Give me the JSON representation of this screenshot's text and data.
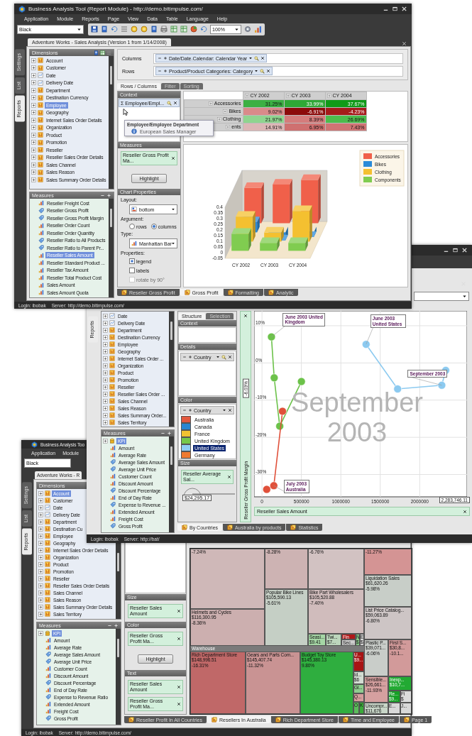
{
  "window_a": {
    "title": "Business Analysis Tool (Report Module) - http://demo.bitimpulse.com/",
    "menu": [
      "Application",
      "Module",
      "Reports",
      "Page",
      "View",
      "Data",
      "Table",
      "Language",
      "Help"
    ],
    "theme_select": "Black",
    "zoom_select": "100%",
    "document_tab": "Adventure Works - Sales Analysis (Version 1 from 1/14/2008)",
    "side_tabs": [
      {
        "label": "Settings",
        "selected": false
      },
      {
        "label": "List",
        "selected": false
      },
      {
        "label": "Reports",
        "selected": true
      }
    ],
    "dimensions": {
      "title": "Dimensions",
      "items": [
        {
          "label": "Account",
          "kind": "dimension",
          "selected": false
        },
        {
          "label": "Customer",
          "kind": "dimension",
          "selected": false
        },
        {
          "label": "Date",
          "kind": "time",
          "selected": false
        },
        {
          "label": "Delivery Date",
          "kind": "time",
          "selected": false
        },
        {
          "label": "Department",
          "kind": "dimension",
          "selected": false
        },
        {
          "label": "Destination Currency",
          "kind": "dimension",
          "selected": false
        },
        {
          "label": "Employee",
          "kind": "dimension",
          "selected": true
        },
        {
          "label": "Geography",
          "kind": "dimension",
          "selected": false
        },
        {
          "label": "Internet Sales Order Details",
          "kind": "dimension",
          "selected": false
        },
        {
          "label": "Organization",
          "kind": "dimension",
          "selected": false
        },
        {
          "label": "Product",
          "kind": "dimension",
          "selected": false
        },
        {
          "label": "Promotion",
          "kind": "dimension",
          "selected": false
        },
        {
          "label": "Reseller",
          "kind": "dimension",
          "selected": false
        },
        {
          "label": "Reseller Sales Order Details",
          "kind": "dimension",
          "selected": false
        },
        {
          "label": "Sales Channel",
          "kind": "dimension",
          "selected": false
        },
        {
          "label": "Sales Reason",
          "kind": "dimension",
          "selected": false
        },
        {
          "label": "Sales Summary Order Details",
          "kind": "dimension",
          "selected": false
        }
      ]
    },
    "measures": {
      "title": "Measures",
      "items": [
        {
          "label": "Reseller Freight Cost",
          "kind": "bars",
          "selected": false
        },
        {
          "label": "Reseller Gross Profit",
          "kind": "calculated",
          "selected": false
        },
        {
          "label": "Reseller Gross Profit Margin",
          "kind": "calculated",
          "selected": false
        },
        {
          "label": "Reseller Order Count",
          "kind": "bars",
          "selected": false
        },
        {
          "label": "Reseller Order Quantity",
          "kind": "bars",
          "selected": false
        },
        {
          "label": "Reseller Ratio to All Products",
          "kind": "calculated",
          "selected": false
        },
        {
          "label": "Reseller Ratio to Parent Pr...",
          "kind": "calculated",
          "selected": false
        },
        {
          "label": "Reseller Sales Amount",
          "kind": "bars",
          "selected": true
        },
        {
          "label": "Reseller Standard Product ...",
          "kind": "bars",
          "selected": false
        },
        {
          "label": "Reseller Tax Amount",
          "kind": "bars",
          "selected": false
        },
        {
          "label": "Reseller Total Product Cost",
          "kind": "bars",
          "selected": false
        },
        {
          "label": "Sales Amount",
          "kind": "bars",
          "selected": false
        },
        {
          "label": "Sales Amount Quota",
          "kind": "bars",
          "selected": false
        }
      ]
    },
    "axes_fields": [
      {
        "label": "Columns",
        "chip": "Date/Date.Calendar: Calendar Year"
      },
      {
        "label": "Rows",
        "chip": "Product/Product Categories: Category"
      }
    ],
    "config_tabs": [
      {
        "label": "Rows / Columns",
        "selected": true
      },
      {
        "label": "Filter",
        "selected": false
      },
      {
        "label": "Sorting",
        "selected": false
      }
    ],
    "context": {
      "title": "Context",
      "chip_symbol": "Σ",
      "chip": "Employee/Empl..."
    },
    "tooltip": {
      "title": "Employee/Employee Department",
      "text": "European Sales Manager"
    },
    "measures_box": {
      "title": "Measures",
      "chip": "Reseller Gross Profit Ma...",
      "button": "Highlight"
    },
    "chart_properties": {
      "title": "Chart Properties",
      "layout_label": "Layout:",
      "layout_value": "bottom",
      "argument_label": "Argument:",
      "argument_options": [
        {
          "label": "rows",
          "selected": false
        },
        {
          "label": "columns",
          "selected": true
        }
      ],
      "type_label": "Type:",
      "type_value": "Manhattan Bar",
      "properties_label": "Properties:",
      "options": [
        {
          "label": "legend",
          "checked": true,
          "disabled": false
        },
        {
          "label": "labels",
          "checked": false,
          "disabled": false
        },
        {
          "label": "rotate by 90°",
          "checked": false,
          "disabled": true
        }
      ]
    },
    "grid": {
      "columns": [
        "CY 2002",
        "CY 2003",
        "CY 2004"
      ],
      "rows": [
        {
          "label": "Accessories",
          "cells": [
            {
              "value": "31.25%",
              "color": "#3cb043"
            },
            {
              "value": "33.99%",
              "color": "#2fa836"
            },
            {
              "value": "37.67%",
              "color": "#109a18"
            }
          ]
        },
        {
          "label": "Bikes",
          "cells": [
            {
              "value": "9.02%",
              "color": "#d98a8a"
            },
            {
              "value": "-6.91%",
              "color": "#8c0a0a"
            },
            {
              "value": "-4.23%",
              "color": "#a51a1a"
            }
          ]
        },
        {
          "label": "Clothing",
          "cells": [
            {
              "value": "21.97%",
              "color": "#8fd48f"
            },
            {
              "value": "8.39%",
              "color": "#d47c7c"
            },
            {
              "value": "26.69%",
              "color": "#4cbc4c"
            }
          ]
        },
        {
          "label": "ents",
          "cells": [
            {
              "value": "14.91%",
              "color": "#dcb6b6"
            },
            {
              "value": "6.95%",
              "color": "#cf7070"
            },
            {
              "value": "7.43%",
              "color": "#d07474"
            }
          ]
        }
      ]
    },
    "chart": {
      "yaxis_labels": [
        "0.4",
        "0.35",
        "0.3",
        "0.25",
        "0.2",
        "0.15",
        "0.1",
        "0.05",
        "0",
        "-0.05"
      ],
      "categories": [
        "CY 2002",
        "CY 2003",
        "CY 2004"
      ],
      "legend": [
        {
          "label": "Accessories",
          "color": "#f0604a"
        },
        {
          "label": "Bikes",
          "color": "#2a8ad8"
        },
        {
          "label": "Clothing",
          "color": "#f4c030"
        },
        {
          "label": "Components",
          "color": "#80cc50"
        }
      ]
    },
    "report_tabs": [
      {
        "label": "Reseller Gross Profit",
        "selected": false
      },
      {
        "label": "Gross Profit",
        "selected": true
      },
      {
        "label": "Formatting",
        "selected": false
      },
      {
        "label": "Analytic",
        "selected": false
      }
    ],
    "status_bar": {
      "login": "Login: ibobak",
      "server": "Server: http://demo.bitimpulse.com/"
    }
  },
  "window_b": {
    "side_tabs": [
      {
        "label": "Reports",
        "selected": true
      }
    ],
    "dimensions": {
      "items": [
        {
          "label": "Date",
          "kind": "time",
          "selected": false
        },
        {
          "label": "Delivery Date",
          "kind": "time",
          "selected": false
        },
        {
          "label": "Department",
          "kind": "dimension",
          "selected": false
        },
        {
          "label": "Destination Currency",
          "kind": "dimension",
          "selected": false
        },
        {
          "label": "Employee",
          "kind": "dimension",
          "selected": false
        },
        {
          "label": "Geography",
          "kind": "dimension",
          "selected": false
        },
        {
          "label": "Internet Sales Order ...",
          "kind": "dimension",
          "selected": false
        },
        {
          "label": "Organization",
          "kind": "dimension",
          "selected": false
        },
        {
          "label": "Product",
          "kind": "dimension",
          "selected": false
        },
        {
          "label": "Promotion",
          "kind": "dimension",
          "selected": false
        },
        {
          "label": "Reseller",
          "kind": "dimension",
          "selected": false
        },
        {
          "label": "Reseller Sales Order ...",
          "kind": "dimension",
          "selected": false
        },
        {
          "label": "Sales Channel",
          "kind": "dimension",
          "selected": false
        },
        {
          "label": "Sales Reason",
          "kind": "dimension",
          "selected": false
        },
        {
          "label": "Sales Summary Order...",
          "kind": "dimension",
          "selected": false
        },
        {
          "label": "Sales Territory",
          "kind": "dimension",
          "selected": false
        }
      ]
    },
    "measures": {
      "title": "Measures",
      "items": [
        {
          "label": "KPI",
          "kind": "kpi",
          "selected": true
        },
        {
          "label": "Amount",
          "kind": "bars",
          "selected": false
        },
        {
          "label": "Average Rate",
          "kind": "bars",
          "selected": false
        },
        {
          "label": "Average Sales Amount",
          "kind": "calculated",
          "selected": false
        },
        {
          "label": "Average Unit Price",
          "kind": "calculated",
          "selected": false
        },
        {
          "label": "Customer Count",
          "kind": "bars",
          "selected": false
        },
        {
          "label": "Discount Amount",
          "kind": "bars",
          "selected": false
        },
        {
          "label": "Discount Percentage",
          "kind": "calculated",
          "selected": false
        },
        {
          "label": "End of Day Rate",
          "kind": "bars",
          "selected": false
        },
        {
          "label": "Expense to Revenue ...",
          "kind": "calculated",
          "selected": false
        },
        {
          "label": "Extended Amount",
          "kind": "bars",
          "selected": false
        },
        {
          "label": "Freight Cost",
          "kind": "bars",
          "selected": false
        },
        {
          "label": "Gross Profit",
          "kind": "calculated",
          "selected": false
        }
      ]
    },
    "structure_tabs": [
      {
        "label": "Structure",
        "selected": true
      },
      {
        "label": "Selection",
        "selected": false
      }
    ],
    "context": {
      "title": "Context"
    },
    "details": {
      "title": "Details",
      "chip": "Country"
    },
    "color_panel": {
      "title": "Color",
      "chip": "Country",
      "legend": [
        {
          "label": "Australia",
          "color": "#e2583e",
          "selected": false
        },
        {
          "label": "Canada",
          "color": "#2a86d0",
          "selected": false
        },
        {
          "label": "France",
          "color": "#f2c232",
          "selected": false
        },
        {
          "label": "United Kingdom",
          "color": "#76c84a",
          "selected": false
        },
        {
          "label": "United States",
          "color": "#8fcdf4",
          "selected": true
        },
        {
          "label": "Germany",
          "color": "#ef7a30",
          "selected": false
        }
      ]
    },
    "size_panel": {
      "title": "Size",
      "chip": "Reseller Average Sal...",
      "value": "$24,295.17"
    },
    "y_field": {
      "cursor": "-6.03%"
    },
    "x_field": {
      "cursor": "2,283,746.11"
    },
    "period_label": "September 2003",
    "chart_data": {
      "type": "scatter",
      "xlabel": "Reseller Sales Amount",
      "ylabel": "Reseller Gross Profit Margin",
      "grid": true,
      "xlim": [
        -100000,
        2600000
      ],
      "ylim": [
        -0.36,
        0.14
      ],
      "xticks": [
        0,
        500000,
        1000000,
        1500000,
        2000000
      ],
      "yticks": [
        {
          "value": 0.1,
          "label": "10%"
        },
        {
          "value": 0,
          "label": "0%"
        },
        {
          "value": -0.1,
          "label": "-10%"
        },
        {
          "value": -0.2,
          "label": "-20%"
        },
        {
          "value": -0.3,
          "label": "-30%"
        }
      ],
      "series": [
        {
          "color": "#6cc24a",
          "x": [
            120000,
            155000,
            225000,
            500000
          ],
          "values": [
            0.07,
            -0.04,
            -0.17,
            -0.05
          ]
        },
        {
          "color": "#e0503a",
          "x": [
            60000,
            150000,
            260000
          ],
          "values": [
            -0.34,
            -0.33,
            -0.13
          ]
        },
        {
          "color": "#8ccaf0",
          "x": [
            1320000,
            1720000,
            2280000,
            2330000
          ],
          "values": [
            0.05,
            -0.07,
            -0.06,
            -0.02
          ]
        }
      ],
      "annotations": [
        {
          "text": "June 2003 United Kingdom",
          "x": 120000,
          "y": 0.07
        },
        {
          "text": "June 2003 United States",
          "x": 1320000,
          "y": 0.05
        },
        {
          "text": "September 2003",
          "x": 2280000,
          "y": -0.06
        },
        {
          "text": "July 2003 Australia",
          "x": 150000,
          "y": -0.33
        }
      ]
    },
    "report_tabs": [
      {
        "label": "By Countries",
        "selected": true
      },
      {
        "label": "Australia by products",
        "selected": false
      },
      {
        "label": "Statistics",
        "selected": false
      }
    ],
    "status_bar": {
      "login": "Login: ibobak",
      "server": "Server: http://bat/"
    }
  },
  "window_c": {
    "title": "Business Analysis Too",
    "menu": [
      "Application",
      "Module"
    ],
    "theme_select": "Black",
    "document_tab": "Adventure Works - R",
    "side_tabs": [
      {
        "label": "Settings",
        "selected": false
      },
      {
        "label": "List",
        "selected": false
      },
      {
        "label": "Reports",
        "selected": true
      }
    ],
    "dimensions": {
      "title": "Dimensions",
      "items": [
        {
          "label": "Account",
          "kind": "dimension",
          "selected": true
        },
        {
          "label": "Customer",
          "kind": "dimension",
          "selected": false
        },
        {
          "label": "Date",
          "kind": "time",
          "selected": false
        },
        {
          "label": "Delivery Date",
          "kind": "time",
          "selected": false
        },
        {
          "label": "Department",
          "kind": "dimension",
          "selected": false
        },
        {
          "label": "Destination Cu",
          "kind": "dimension",
          "selected": false
        },
        {
          "label": "Employee",
          "kind": "dimension",
          "selected": false
        },
        {
          "label": "Geography",
          "kind": "dimension",
          "selected": false
        },
        {
          "label": "Internet Sales Order Details",
          "kind": "dimension",
          "selected": false
        },
        {
          "label": "Organization",
          "kind": "dimension",
          "selected": false
        },
        {
          "label": "Product",
          "kind": "dimension",
          "selected": false
        },
        {
          "label": "Promotion",
          "kind": "dimension",
          "selected": false
        },
        {
          "label": "Reseller",
          "kind": "dimension",
          "selected": false
        },
        {
          "label": "Reseller Sales Order Details",
          "kind": "dimension",
          "selected": false
        },
        {
          "label": "Sales Channel",
          "kind": "dimension",
          "selected": false
        },
        {
          "label": "Sales Reason",
          "kind": "dimension",
          "selected": false
        },
        {
          "label": "Sales Summary Order Details",
          "kind": "dimension",
          "selected": false
        },
        {
          "label": "Sales Territory",
          "kind": "dimension",
          "selected": false
        }
      ]
    },
    "measures": {
      "title": "Measures",
      "items": [
        {
          "label": "KPI",
          "kind": "kpi",
          "selected": true
        },
        {
          "label": "Amount",
          "kind": "bars",
          "selected": false
        },
        {
          "label": "Average Rate",
          "kind": "bars",
          "selected": false
        },
        {
          "label": "Average Sales Amount",
          "kind": "calculated",
          "selected": false
        },
        {
          "label": "Average Unit Price",
          "kind": "calculated",
          "selected": false
        },
        {
          "label": "Customer Count",
          "kind": "bars",
          "selected": false
        },
        {
          "label": "Discount Amount",
          "kind": "bars",
          "selected": false
        },
        {
          "label": "Discount Percentage",
          "kind": "calculated",
          "selected": false
        },
        {
          "label": "End of Day Rate",
          "kind": "bars",
          "selected": false
        },
        {
          "label": "Expense to Revenue Ratio",
          "kind": "calculated",
          "selected": false
        },
        {
          "label": "Extended Amount",
          "kind": "bars",
          "selected": false
        },
        {
          "label": "Freight Cost",
          "kind": "bars",
          "selected": false
        },
        {
          "label": "Gross Profit",
          "kind": "calculated",
          "selected": false
        }
      ]
    },
    "size_panel": {
      "title": "Size",
      "chip": "Reseller Sales Amount"
    },
    "color_panel": {
      "title": "Color",
      "chip": "Reseller Gross Profit Ma...",
      "button": "Highlight"
    },
    "text_panel": {
      "title": "Text",
      "chips": [
        "Reseller Sales Amount",
        "Reseller Gross Profit Ma..."
      ]
    },
    "treemap": {
      "group_label": "Warehouse",
      "cells": [
        {
          "lines": [
            "-7.24%"
          ],
          "color": "#cfb8b8"
        },
        {
          "lines": [
            "-8.28%"
          ],
          "color": "#cdb3b3"
        },
        {
          "lines": [
            "-6.76%"
          ],
          "color": "#d2c2c2"
        },
        {
          "lines": [
            "-11.27%"
          ],
          "color": "#d49494"
        },
        {
          "lines": [
            "Liquidation Sales",
            "$61,620.26",
            "-5.98%"
          ],
          "color": "#c8cec8"
        },
        {
          "lines": [
            "Popular Bike Lines",
            "$105,590.13",
            "-5.61%"
          ],
          "color": "#c5cfc5"
        },
        {
          "lines": [
            "Bike Part Wholesalers",
            "$105,520.88",
            "-7.40%"
          ],
          "color": "#d0bcbc"
        },
        {
          "lines": [
            "Helmets and Cycles",
            "$116,300.95",
            "-8.36%"
          ],
          "color": "#ccafaf"
        },
        {
          "lines": [
            "List Price Catalog...",
            "$59,063.89",
            "-6.80%"
          ],
          "color": "#cdc5c5"
        },
        {
          "lines": [
            "Seasi...",
            "$9.41"
          ],
          "color": "#a5d6a5"
        },
        {
          "lines": [
            "Twi...",
            "$7..."
          ],
          "color": "#bcd6bc"
        },
        {
          "lines": [
            "Fin"
          ],
          "color": "#b01818"
        },
        {
          "lines": [
            "Sec..."
          ],
          "color": "#cccccc"
        },
        {
          "lines": [
            "N",
            "$"
          ],
          "color": "#8ccc8c"
        },
        {
          "lines": [
            "E",
            "$"
          ],
          "color": "#d8d8d8"
        },
        {
          "lines": [
            "Rich Department Store",
            "$148,996.51",
            "-16.31%"
          ],
          "color": "#c06868"
        },
        {
          "lines": [
            "Gears and Parts Com...",
            "$145,407.74",
            "-11.32%"
          ],
          "color": "#c99393"
        },
        {
          "lines": [
            "Budget Toy Store",
            "$145,380.13",
            "9.80%"
          ],
          "color": "#2fae3f"
        },
        {
          "lines": [
            "U...",
            "$9..."
          ],
          "color": "#a81414"
        },
        {
          "lines": [
            "Id...",
            "$6"
          ],
          "color": "#d2dcd2"
        },
        {
          "lines": [
            "Gl..."
          ],
          "color": "#8fcc8f"
        },
        {
          "lines": [
            "Q..."
          ],
          "color": "#d59c9c"
        },
        {
          "lines": [
            "O"
          ],
          "color": "#5cbc5c"
        },
        {
          "lines": [
            "K"
          ],
          "color": "#3aaa3a"
        },
        {
          "lines": [
            "Plastic P...",
            "$39,071...",
            "-6.06%"
          ],
          "color": "#c9cdc9"
        },
        {
          "lines": [
            "First S...",
            "$30,8...",
            "-10.1..."
          ],
          "color": "#d29a9a"
        },
        {
          "lines": [
            "Sensible...",
            "$26,661...",
            "-11.93%"
          ],
          "color": "#d5a0a0"
        },
        {
          "lines": [
            "Inexp...",
            "$10,7..."
          ],
          "color": "#22aa33"
        },
        {
          "lines": [
            "Re...",
            "$9..."
          ],
          "color": "#16a026"
        },
        {
          "lines": [
            "Fi",
            "$"
          ],
          "color": "#dcdcdc"
        },
        {
          "lines": [
            "Uncompr...",
            "$11,676"
          ],
          "color": "#c8d6c8"
        },
        {
          "lines": [
            "E..."
          ],
          "color": "#d8d8d8"
        },
        {
          "lines": [
            "J..."
          ],
          "color": "#d8d8d8"
        }
      ]
    },
    "report_tabs": [
      {
        "label": "Reseller Profit In All Countries",
        "selected": false
      },
      {
        "label": "Resellers In Australia",
        "selected": true
      },
      {
        "label": "Rich Department Store",
        "selected": false
      },
      {
        "label": "Time and Employee",
        "selected": false
      },
      {
        "label": "Page 1",
        "selected": false
      }
    ],
    "status_bar": {
      "login": "Login: ibobak",
      "server": "Server: http://demo.bitimpulse.com/"
    }
  }
}
